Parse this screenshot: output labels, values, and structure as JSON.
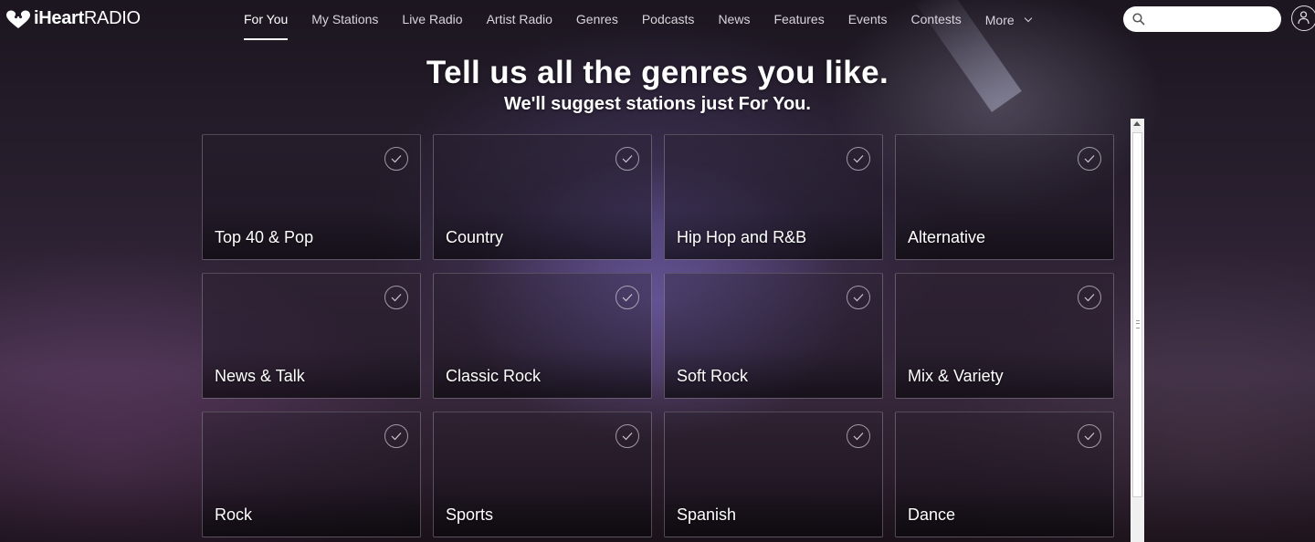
{
  "brand": {
    "logo_icon": "iheart-logo-icon",
    "name_bold": "iHeart",
    "name_thin": "RADIO"
  },
  "nav": {
    "items": [
      {
        "label": "For You",
        "active": true
      },
      {
        "label": "My Stations"
      },
      {
        "label": "Live Radio"
      },
      {
        "label": "Artist Radio"
      },
      {
        "label": "Genres"
      },
      {
        "label": "Podcasts"
      },
      {
        "label": "News"
      },
      {
        "label": "Features"
      },
      {
        "label": "Events"
      },
      {
        "label": "Contests"
      },
      {
        "label": "More"
      }
    ]
  },
  "search": {
    "placeholder": "",
    "icon": "search-icon"
  },
  "user": {
    "icon": "user-icon"
  },
  "hero": {
    "headline": "Tell us all the genres you like.",
    "subhead": "We'll suggest stations just For You."
  },
  "genres": [
    {
      "label": "Top 40 & Pop",
      "selected": false
    },
    {
      "label": "Country",
      "selected": false
    },
    {
      "label": "Hip Hop and R&B",
      "selected": false
    },
    {
      "label": "Alternative",
      "selected": false
    },
    {
      "label": "News & Talk",
      "selected": false
    },
    {
      "label": "Classic Rock",
      "selected": false
    },
    {
      "label": "Soft Rock",
      "selected": false
    },
    {
      "label": "Mix & Variety",
      "selected": false
    },
    {
      "label": "Rock",
      "selected": false
    },
    {
      "label": "Sports",
      "selected": false
    },
    {
      "label": "Spanish",
      "selected": false
    },
    {
      "label": "Dance",
      "selected": false
    }
  ],
  "colors": {
    "accent": "#ffffff",
    "text_muted": "#d9d4dc"
  }
}
